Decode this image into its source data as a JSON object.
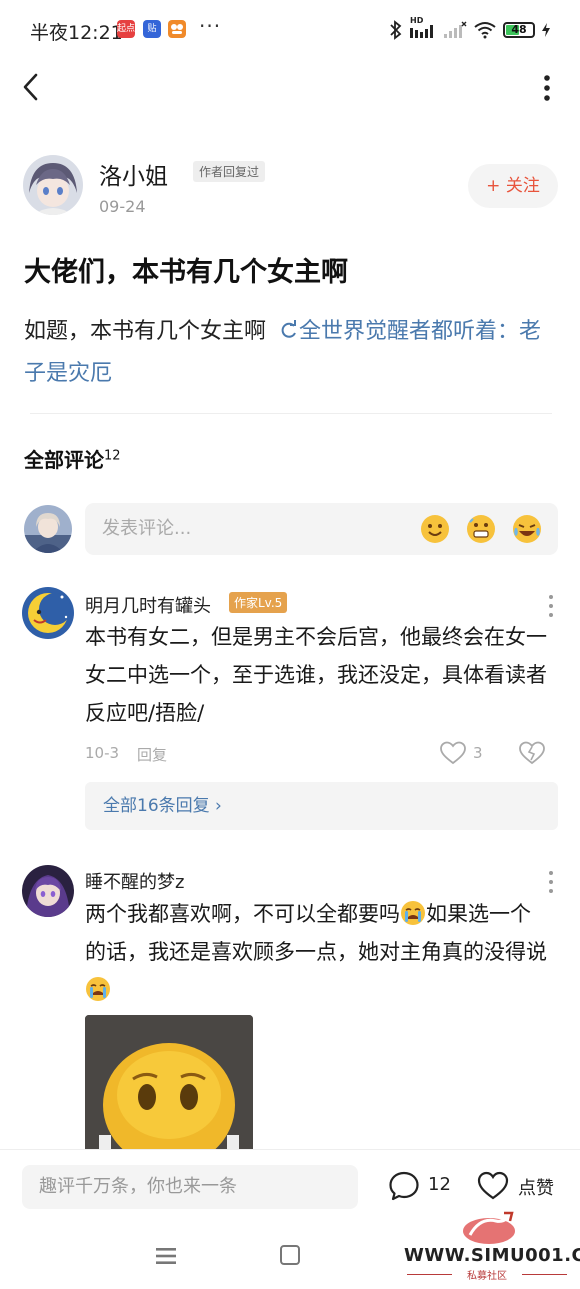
{
  "status_bar": {
    "time": "半夜12:21",
    "app_icons": [
      {
        "name": "qidian-icon",
        "label": "起点",
        "color": "#e64040"
      },
      {
        "name": "tieba-icon",
        "label": "贴",
        "color": "#3465d8"
      },
      {
        "name": "app-icon",
        "label": "",
        "color": "#f08a2a"
      }
    ],
    "overflow": "···",
    "signal_label": "HD",
    "battery_level": "48"
  },
  "post": {
    "author_name": "洛小姐",
    "author_badge": "作者回复过",
    "date": "09-24",
    "follow_label": "+ 关注",
    "title": "大佬们，本书有几个女主啊",
    "body_text": "如题，本书有几个女主啊",
    "body_link": "全世界觉醒者都听着：老子是灾厄"
  },
  "comments_section": {
    "header": "全部评论",
    "count": "12",
    "composer_placeholder": "发表评论...",
    "emoji_buttons": [
      "smile-emoji-icon",
      "grimace-emoji-icon",
      "laugh-cry-emoji-icon"
    ]
  },
  "comments": [
    {
      "user": "明月几时有罐头",
      "badge": "作家Lv.5",
      "text": "本书有女二，但是男主不会后宫，他最终会在女一女二中选一个，至于选谁，我还没定，具体看读者反应吧/捂脸/",
      "date": "10-3",
      "reply_label": "回复",
      "likes": "3",
      "replies_link": "全部16条回复 ›"
    },
    {
      "user": "睡不醒的梦z",
      "text_parts": [
        "两个我都喜欢啊，不可以全都要吗",
        "如果选一个的话，我还是喜欢顾多一点，她对主角真的没得说"
      ]
    }
  ],
  "bottom_bar": {
    "input_placeholder": "趣评千万条，你也来一条",
    "comment_count": "12",
    "like_label": "点赞"
  },
  "watermark": {
    "text": "WWW.SIMU001.CN",
    "subtext": "私募社区"
  }
}
